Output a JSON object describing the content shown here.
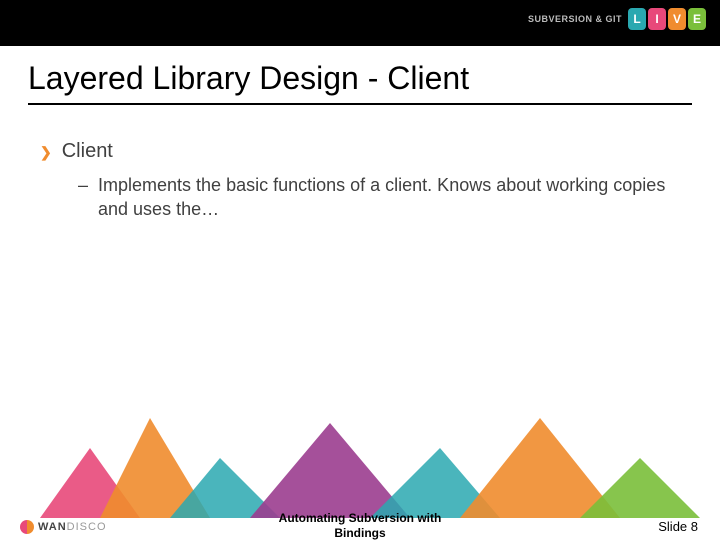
{
  "header": {
    "brand_text": "SUBVERSION & GIT",
    "live_letters": [
      "L",
      "I",
      "V",
      "E"
    ]
  },
  "title": "Layered Library Design - Client",
  "bullets": {
    "main": "Client",
    "sub_dash": "–",
    "sub_text": "Implements the basic functions of a client.  Knows about working copies and uses the…"
  },
  "footer": {
    "center_line1": "Automating Subversion with",
    "center_line2": "Bindings",
    "slide_label": "Slide 8",
    "logo_main": "WAN",
    "logo_sub": "DISCO"
  }
}
